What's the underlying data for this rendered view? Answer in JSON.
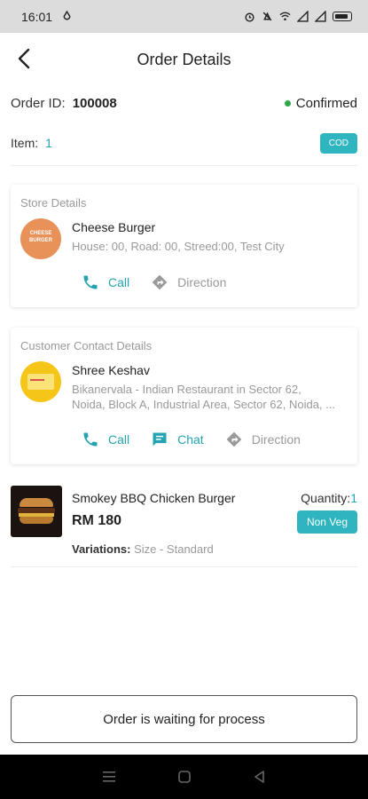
{
  "status_bar": {
    "time": "16:01"
  },
  "header": {
    "title": "Order Details",
    "back_icon": "back-arrow-icon"
  },
  "order": {
    "id_label": "Order ID:",
    "id_value": "100008",
    "status": "Confirmed",
    "status_color": "#2ea84a",
    "item_label": "Item:",
    "item_count": "1",
    "payment_badge": "COD"
  },
  "store": {
    "section_title": "Store Details",
    "name": "Cheese Burger",
    "logo_text_top": "CHEESE",
    "logo_text_bottom": "BURGER",
    "address": "House: 00, Road: 00, Streed:00, Test City",
    "actions": {
      "call": "Call",
      "direction": "Direction"
    }
  },
  "customer": {
    "section_title": "Customer Contact Details",
    "name": "Shree Keshav",
    "address_line1": "Bikanervala - Indian Restaurant in Sector 62,",
    "address_line2": "Noida, Block A, Industrial Area, Sector 62, Noida, ...",
    "actions": {
      "call": "Call",
      "chat": "Chat",
      "direction": "Direction"
    }
  },
  "product": {
    "name": "Smokey BBQ Chicken Burger",
    "price": "RM 180",
    "quantity_label": "Quantity:",
    "quantity_value": "1",
    "veg_badge": "Non Veg",
    "variations_label": "Variations:",
    "variations_value": "Size - Standard"
  },
  "footer": {
    "button_label": "Order is waiting for process"
  },
  "colors": {
    "accent": "#25a3b0",
    "badge_bg": "#2fb5bf",
    "muted_text": "#999999"
  }
}
